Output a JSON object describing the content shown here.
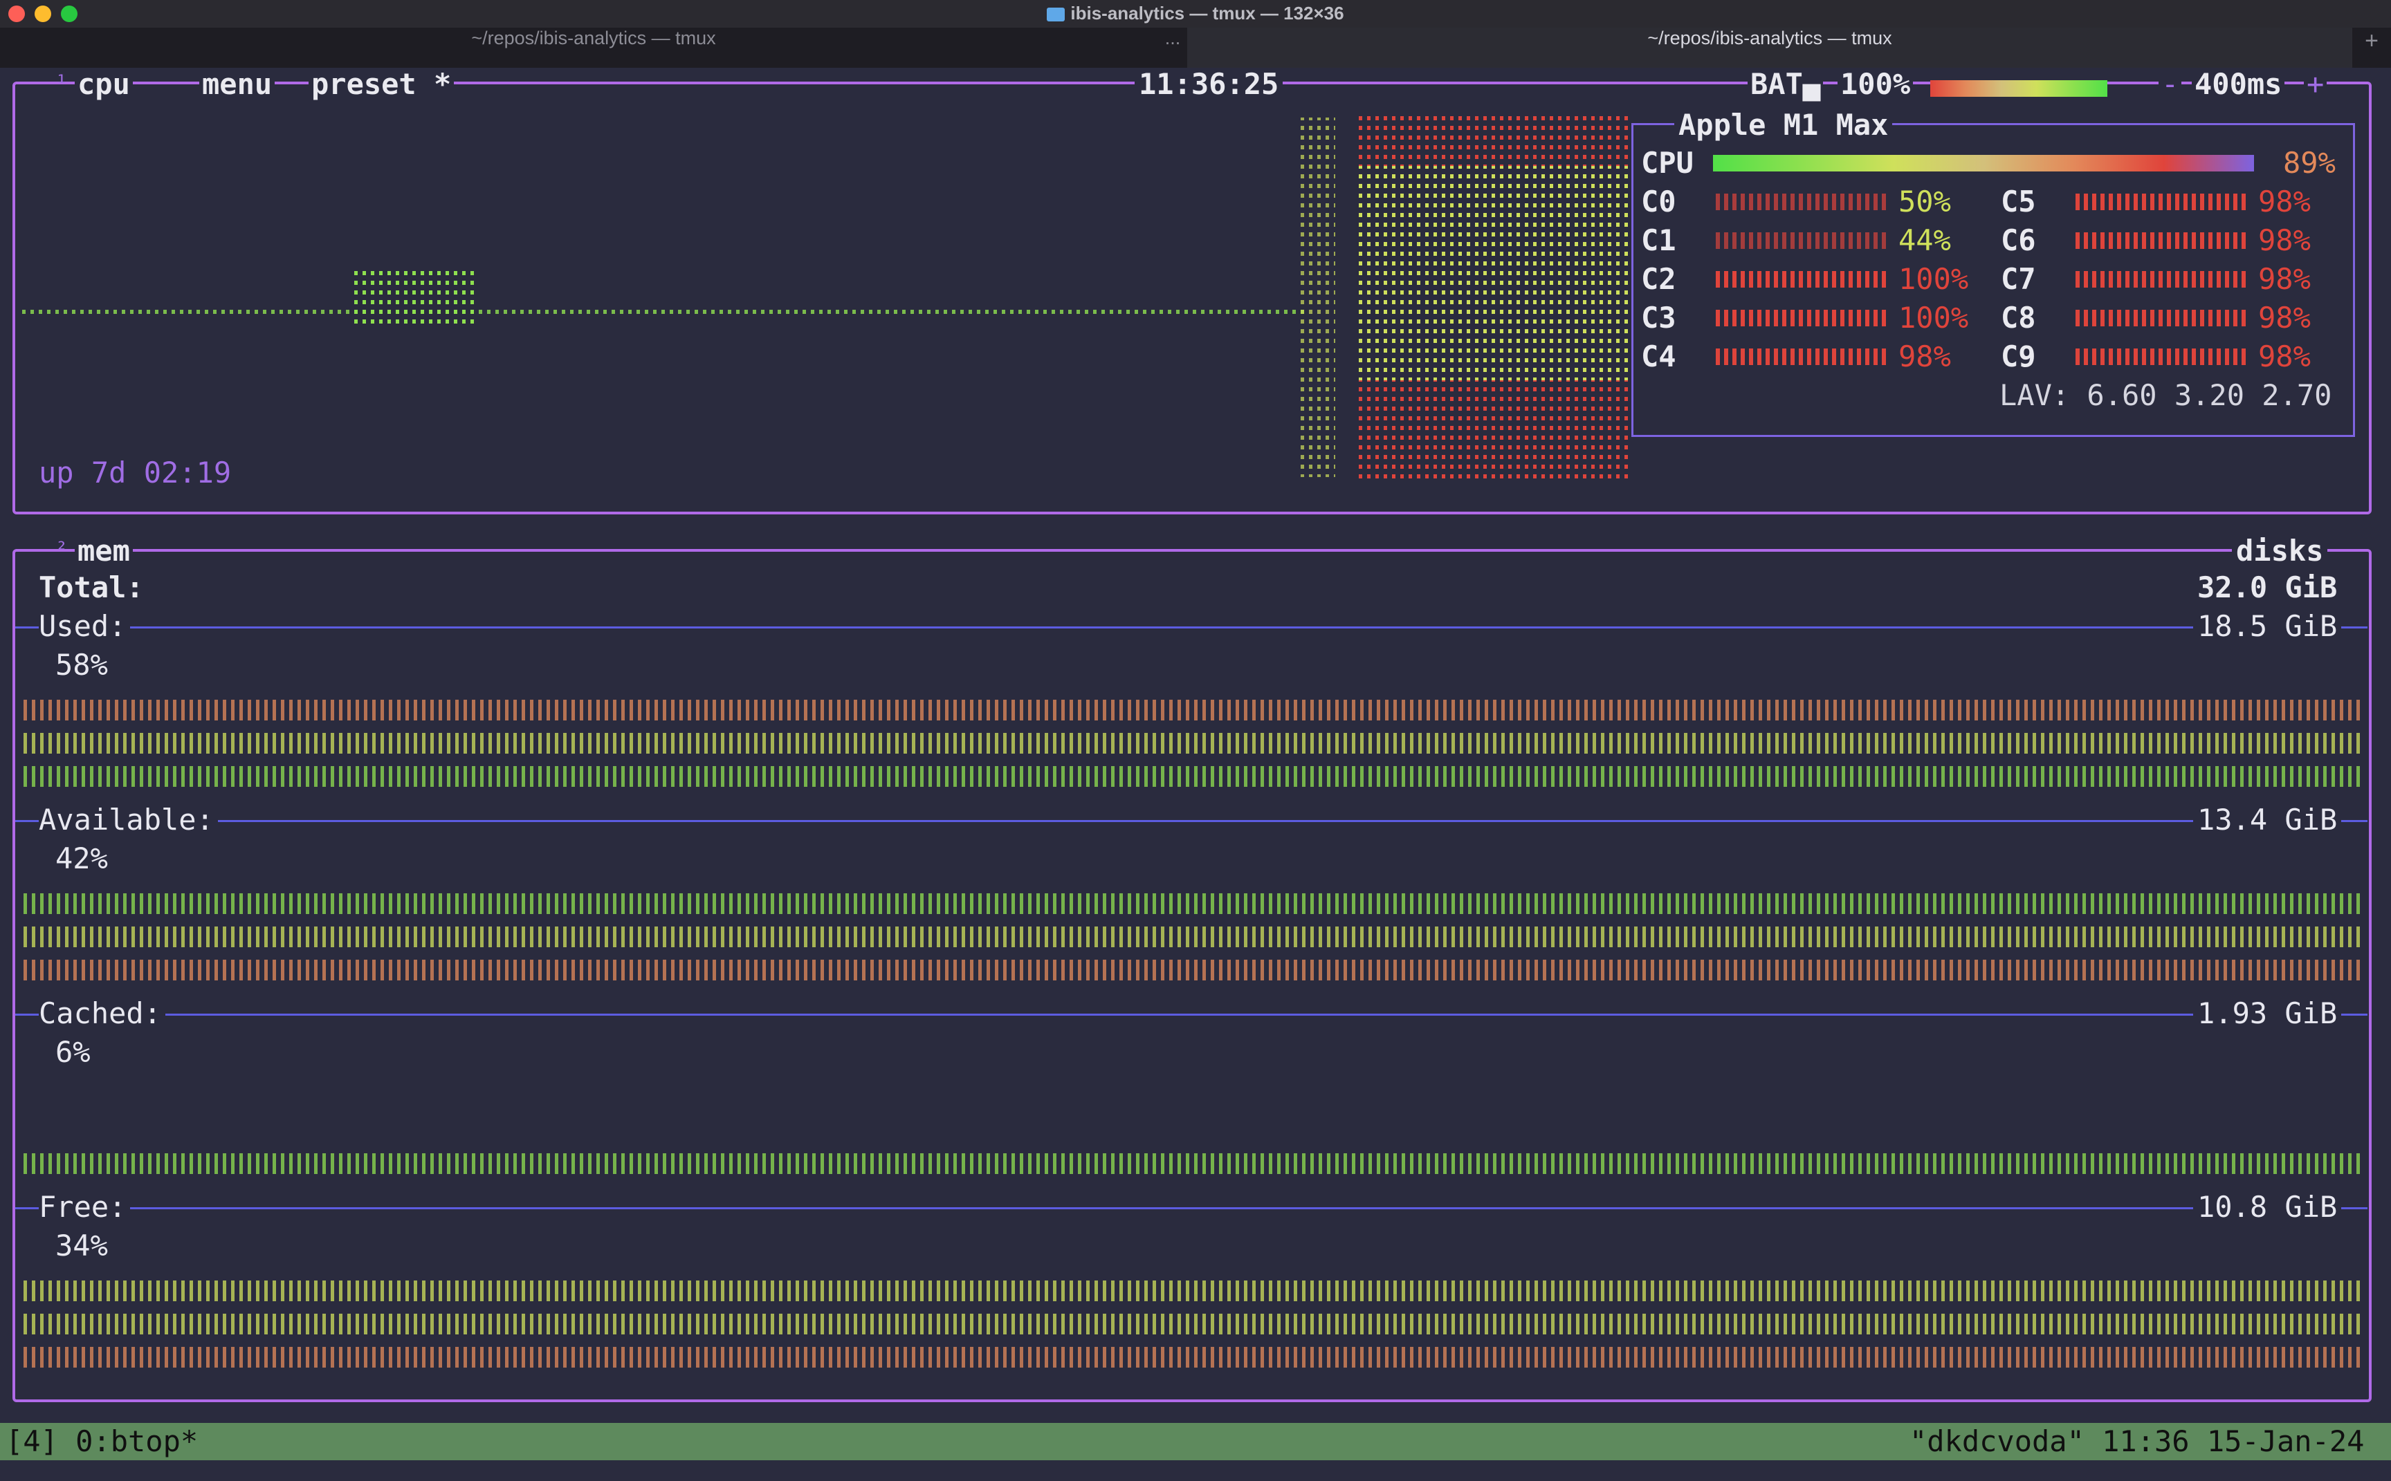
{
  "window": {
    "title": "ibis-analytics — tmux — 132×36"
  },
  "tabs": [
    {
      "label": "~/repos/ibis-analytics — tmux"
    },
    {
      "label": "~/repos/ibis-analytics — tmux"
    }
  ],
  "tab_overflow": "...",
  "new_tab": "+",
  "cpu_box": {
    "num": "¹",
    "title": "cpu",
    "menu": "menu",
    "preset": "preset *",
    "clock": "11:36:25",
    "battery_label": "BAT▄",
    "battery_pct": "100%",
    "refresh_minus": "-",
    "refresh_rate": "400ms",
    "refresh_plus": "+",
    "uptime": "up 7d 02:19",
    "model": "Apple M1 Max",
    "total_label": "CPU",
    "total_pct": "89%",
    "cores": [
      {
        "name": "C0",
        "pct": "50%",
        "val": 0.5
      },
      {
        "name": "C1",
        "pct": "44%",
        "val": 0.44
      },
      {
        "name": "C2",
        "pct": "100%",
        "val": 1.0
      },
      {
        "name": "C3",
        "pct": "100%",
        "val": 1.0
      },
      {
        "name": "C4",
        "pct": "98%",
        "val": 0.98
      },
      {
        "name": "C5",
        "pct": "98%",
        "val": 0.98
      },
      {
        "name": "C6",
        "pct": "98%",
        "val": 0.98
      },
      {
        "name": "C7",
        "pct": "98%",
        "val": 0.98
      },
      {
        "name": "C8",
        "pct": "98%",
        "val": 0.98
      },
      {
        "name": "C9",
        "pct": "98%",
        "val": 0.98
      }
    ],
    "load_avg": "LAV: 6.60 3.20 2.70"
  },
  "mem_box": {
    "num": "²",
    "title": "mem",
    "disks": "disks",
    "total_label": "Total:",
    "total_value": "32.0 GiB",
    "rows": [
      {
        "label": "Used:",
        "value": "18.5 GiB",
        "pct": "58%"
      },
      {
        "label": "Available:",
        "value": "13.4 GiB",
        "pct": "42%"
      },
      {
        "label": "Cached:",
        "value": "1.93 GiB",
        "pct": "6%"
      },
      {
        "label": "Free:",
        "value": "10.8 GiB",
        "pct": "34%"
      }
    ]
  },
  "statusbar": {
    "left": "[4] 0:btop*",
    "right": "\"dkdcvoda\" 11:36 15-Jan-24"
  },
  "colors": {
    "accent": "#b06ae8",
    "bg": "#2a2b3e",
    "green": "#8fe04f",
    "red": "#e0443b",
    "orange": "#e3895a",
    "status_bg": "#5e8a5d"
  }
}
